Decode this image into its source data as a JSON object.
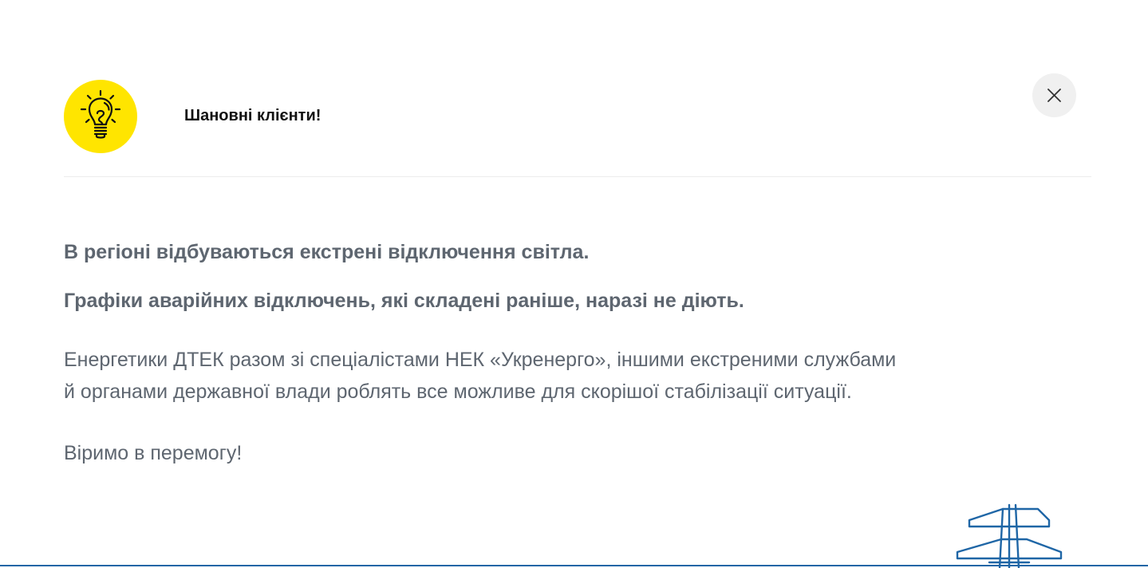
{
  "header": {
    "title": "Шановні клієнти!",
    "icon": "lightbulb-icon",
    "icon_bg_color": "#ffe500"
  },
  "close_button": {
    "icon": "close-icon"
  },
  "message": {
    "line1": "В регіоні відбуваються екстрені відключення світла.",
    "line2": "Графіки аварійних відключень, які складені раніше, наразі не діють.",
    "paragraph_line1": "Енергетики ДТЕК разом зі спеціалістами НЕК «Укренерго», іншими екстреними службами",
    "paragraph_line2": "й органами державної влади роблять все можливе для скорішої стабілізації ситуації.",
    "closing": "Віримо в перемогу!"
  },
  "decoration": {
    "icon": "power-tower-icon",
    "accent_color": "#1f66a6",
    "text_color": "#5e6670"
  }
}
